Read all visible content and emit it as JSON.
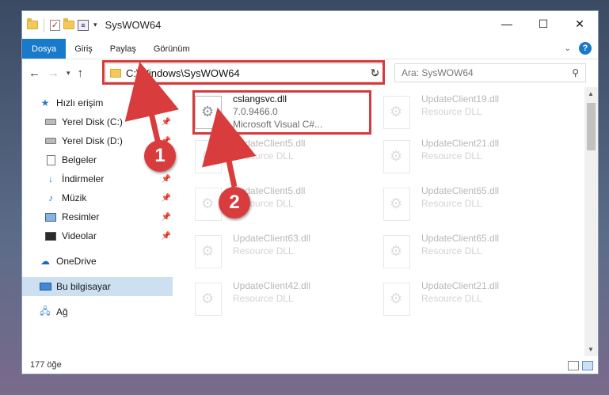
{
  "window": {
    "title": "SysWOW64",
    "controls": [
      "—",
      "☐",
      "✕"
    ]
  },
  "ribbon": {
    "tabs": [
      "Dosya",
      "Giriş",
      "Paylaş",
      "Görünüm"
    ],
    "help": "?"
  },
  "address": {
    "path": "C:\\Windows\\SysWOW64",
    "search_placeholder": "Ara: SysWOW64"
  },
  "sidebar": {
    "items": [
      {
        "label": "Hızlı erişim",
        "icon": "star-icon"
      },
      {
        "label": "Yerel Disk (C:)",
        "icon": "drive-icon"
      },
      {
        "label": "Yerel Disk (D:)",
        "icon": "drive-icon"
      },
      {
        "label": "Belgeler",
        "icon": "documents-icon"
      },
      {
        "label": "İndirmeler",
        "icon": "download-icon"
      },
      {
        "label": "Müzik",
        "icon": "music-icon"
      },
      {
        "label": "Resimler",
        "icon": "pictures-icon"
      },
      {
        "label": "Videolar",
        "icon": "videos-icon"
      },
      {
        "label": "OneDrive",
        "icon": "cloud-icon"
      },
      {
        "label": "Bu bilgisayar",
        "icon": "computer-icon"
      },
      {
        "label": "Ağ",
        "icon": "network-icon"
      }
    ]
  },
  "files": {
    "highlighted": {
      "name": "cslangsvc.dll",
      "version": "7.0.9466.0",
      "description": "Microsoft Visual C#..."
    },
    "col1": [
      {
        "name": "UpdateClient5.dll",
        "type": "Resource DLL"
      },
      {
        "name": "UpdateClient5.dll",
        "type": "Resource DLL"
      },
      {
        "name": "UpdateClient63.dll",
        "type": "Resource DLL"
      },
      {
        "name": "UpdateClient42.dll",
        "type": "Resource DLL"
      }
    ],
    "col2": [
      {
        "name": "UpdateClient19.dll",
        "type": "Resource DLL"
      },
      {
        "name": "UpdateClient21.dll",
        "type": "Resource DLL"
      },
      {
        "name": "UpdateClient65.dll",
        "type": "Resource DLL"
      },
      {
        "name": "UpdateClient65.dll",
        "type": "Resource DLL"
      },
      {
        "name": "UpdateClient21.dll",
        "type": "Resource DLL"
      }
    ]
  },
  "status": {
    "count": "177 öğe"
  },
  "annotations": {
    "step1": "1",
    "step2": "2",
    "color": "#d93c3c"
  }
}
